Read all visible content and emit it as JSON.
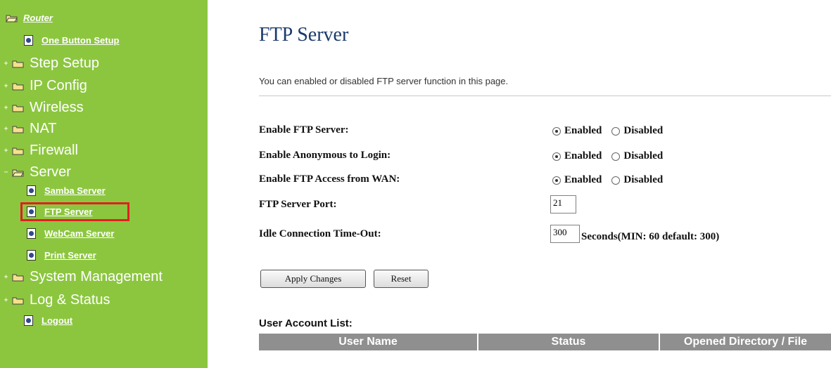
{
  "sidebar": {
    "items": [
      {
        "label": "Router",
        "type": "root"
      },
      {
        "label": "One Button Setup",
        "type": "link"
      },
      {
        "label": "Step Setup",
        "type": "folder"
      },
      {
        "label": "IP Config",
        "type": "folder"
      },
      {
        "label": "Wireless",
        "type": "folder"
      },
      {
        "label": "NAT",
        "type": "folder"
      },
      {
        "label": "Firewall",
        "type": "folder"
      },
      {
        "label": "Server",
        "type": "folder-open"
      },
      {
        "label": "Samba Server",
        "type": "link"
      },
      {
        "label": "FTP Server",
        "type": "link",
        "selected": true
      },
      {
        "label": "WebCam Server",
        "type": "link"
      },
      {
        "label": "Print Server",
        "type": "link"
      },
      {
        "label": "System Management",
        "type": "folder"
      },
      {
        "label": "Log & Status",
        "type": "folder"
      },
      {
        "label": "Logout",
        "type": "link"
      }
    ],
    "expand_plus": "+",
    "expand_minus": "−"
  },
  "page": {
    "title": "FTP Server",
    "description": "You can enabled or disabled FTP server function in this page."
  },
  "form": {
    "enable_ftp_label": "Enable FTP Server:",
    "anonymous_label": "Enable Anonymous to Login:",
    "wan_access_label": "Enable FTP Access from WAN:",
    "port_label": "FTP Server Port:",
    "idle_label": "Idle Connection Time-Out:",
    "enabled_text": "Enabled",
    "disabled_text": "Disabled",
    "port_value": "21",
    "idle_value": "300",
    "idle_unit": "Seconds(MIN: 60 default: 300)"
  },
  "buttons": {
    "apply": "Apply Changes",
    "reset": "Reset"
  },
  "user_list": {
    "title": "User Account List:",
    "columns": [
      "User Name",
      "Status",
      "Opened Directory / File"
    ]
  },
  "colors": {
    "sidebar_bg": "#8cc63f",
    "title": "#1a3a6b",
    "highlight": "#e02020",
    "table_header": "#8f8f8f"
  }
}
